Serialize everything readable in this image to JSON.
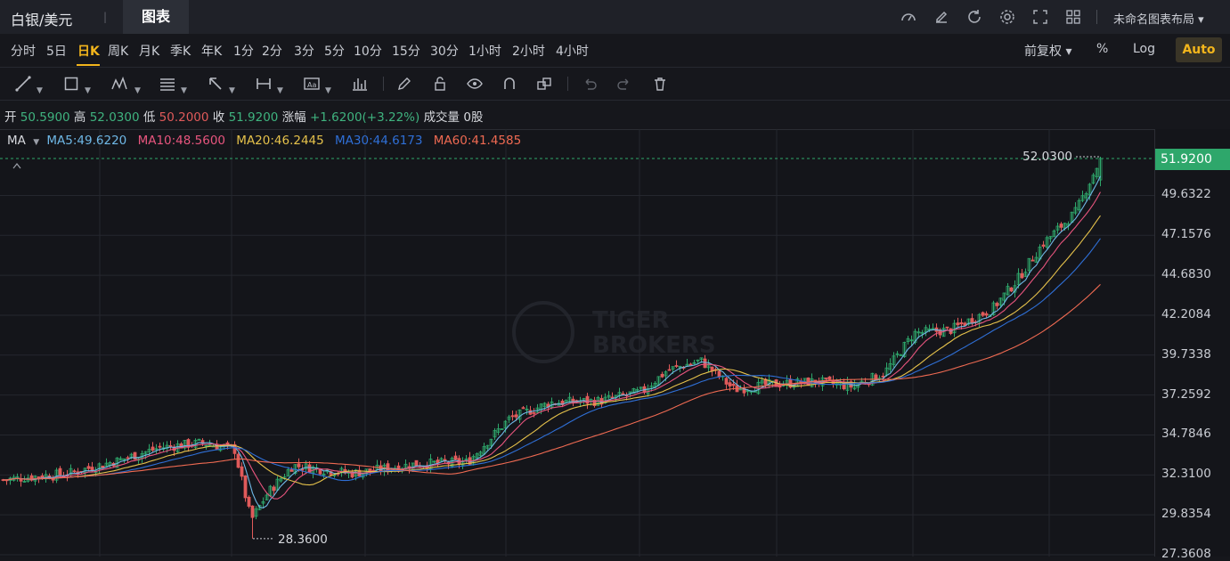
{
  "header": {
    "symbol": "白银/美元",
    "separator": "|",
    "active_tab": "图表",
    "layout_name": "未命名图表布局 ▾",
    "icons": [
      "speedometer-icon",
      "edit-icon",
      "refresh-icon",
      "settings-icon",
      "fullscreen-icon",
      "grid-icon"
    ]
  },
  "intervals": [
    "分时",
    "5日",
    "日K",
    "周K",
    "月K",
    "季K",
    "年K",
    "1分",
    "2分",
    "3分",
    "5分",
    "10分",
    "15分",
    "30分",
    "1小时",
    "2小时",
    "4小时"
  ],
  "active_interval": "日K",
  "right_options": {
    "adjust": "前复权 ▾",
    "percent": "%",
    "log": "Log",
    "auto": "Auto"
  },
  "ohlc": {
    "open_label": "开",
    "open": "50.5900",
    "high_label": "高",
    "high": "52.0300",
    "low_label": "低",
    "low": "50.2000",
    "close_label": "收",
    "close": "51.9200",
    "change_label": "涨幅",
    "change": "+1.6200(+3.22%)",
    "volume_label": "成交量",
    "volume": "0股"
  },
  "ma_legend": {
    "label": "MA",
    "ma5": "MA5:49.6220",
    "ma10": "MA10:48.5600",
    "ma20": "MA20:46.2445",
    "ma30": "MA30:44.6173",
    "ma60": "MA60:41.4585"
  },
  "colors": {
    "up": "#2ea76b",
    "down": "#e05a5a",
    "ma5": "#6fb8e6",
    "ma10": "#e8557e",
    "ma20": "#e6c24b",
    "ma30": "#2f6fd6",
    "ma60": "#ef6a52"
  },
  "price_axis": [
    "51.9200",
    "49.6322",
    "47.1576",
    "44.6830",
    "42.2084",
    "39.7338",
    "37.2592",
    "34.7846",
    "32.3100",
    "29.8354",
    "27.3608"
  ],
  "last_price": "51.9200",
  "annotations": {
    "high": "52.0300",
    "low": "28.3600"
  },
  "watermark": "TIGER BROKERS",
  "chart_data": {
    "type": "candlestick",
    "x_unit": "trading days (daily bars)",
    "y_range": [
      27.3608,
      52.5
    ],
    "last_close": 51.92,
    "period_high": 52.03,
    "period_low": 28.36,
    "close_path_keypoints": [
      [
        0,
        32.0
      ],
      [
        40,
        32.4
      ],
      [
        70,
        33.2
      ],
      [
        95,
        34.0
      ],
      [
        120,
        34.3
      ],
      [
        140,
        33.9
      ],
      [
        150,
        29.5
      ],
      [
        160,
        31.2
      ],
      [
        175,
        32.9
      ],
      [
        210,
        32.4
      ],
      [
        250,
        33.0
      ],
      [
        280,
        33.1
      ],
      [
        305,
        35.8
      ],
      [
        330,
        36.8
      ],
      [
        360,
        36.9
      ],
      [
        385,
        37.5
      ],
      [
        400,
        38.8
      ],
      [
        420,
        39.4
      ],
      [
        440,
        37.6
      ],
      [
        460,
        37.9
      ],
      [
        490,
        38.1
      ],
      [
        510,
        37.8
      ],
      [
        530,
        38.6
      ],
      [
        548,
        41.1
      ],
      [
        570,
        41.3
      ],
      [
        595,
        42.6
      ],
      [
        610,
        44.4
      ],
      [
        625,
        46.6
      ],
      [
        645,
        48.6
      ],
      [
        660,
        51.9
      ]
    ],
    "ma_last": {
      "MA5": 49.622,
      "MA10": 48.56,
      "MA20": 46.2445,
      "MA30": 44.6173,
      "MA60": 41.4585
    }
  }
}
